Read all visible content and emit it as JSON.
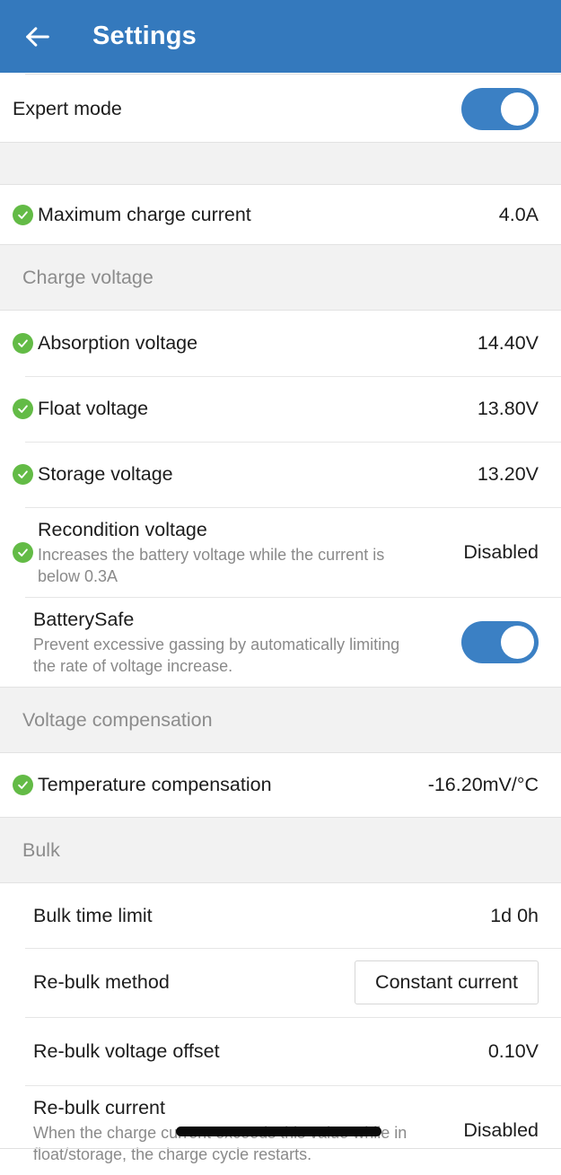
{
  "appbar": {
    "back_icon": "back-arrow-icon",
    "title": "Settings"
  },
  "rows": {
    "expert_mode": {
      "title": "Expert mode",
      "toggle_state": "on"
    },
    "maximum_charge_current": {
      "title": "Maximum charge current",
      "value": "4.0A"
    },
    "charge_voltage_section": {
      "label": "Charge voltage"
    },
    "absorption_voltage": {
      "title": "Absorption voltage",
      "value": "14.40V"
    },
    "float_voltage": {
      "title": "Float voltage",
      "value": "13.80V"
    },
    "storage_voltage": {
      "title": "Storage voltage",
      "value": "13.20V"
    },
    "recondition_voltage": {
      "title": "Recondition voltage",
      "subtitle": "Increases the battery voltage while the current is below 0.3A",
      "value": "Disabled"
    },
    "battery_safe": {
      "title": "BatterySafe",
      "subtitle": "Prevent excessive gassing by automatically limiting the rate of voltage increase.",
      "toggle_state": "on"
    },
    "voltage_compensation_section": {
      "label": "Voltage compensation"
    },
    "temperature_compensation": {
      "title": "Temperature compensation",
      "value": "-16.20mV/°C"
    },
    "bulk_section": {
      "label": "Bulk"
    },
    "bulk_time_limit": {
      "title": "Bulk time limit",
      "value": "1d 0h"
    },
    "rebulk_method": {
      "title": "Re-bulk method",
      "value": "Constant current"
    },
    "rebulk_voltage_offset": {
      "title": "Re-bulk voltage offset",
      "value": "0.10V"
    },
    "rebulk_current": {
      "title": "Re-bulk current",
      "subtitle": "When the charge current exceeds this value while in float/storage, the charge cycle restarts.",
      "value": "Disabled"
    }
  },
  "colors": {
    "appbar_blue": "#3479bd",
    "toggle_blue": "#3b80c4",
    "check_green": "#63bb46",
    "section_bg": "#f2f2f2"
  }
}
